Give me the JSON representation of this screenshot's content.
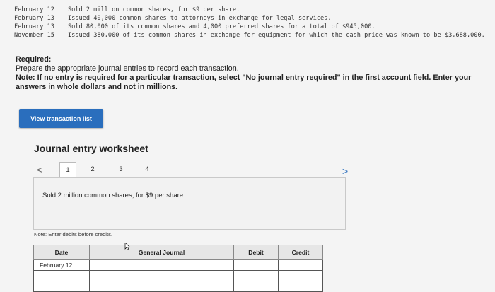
{
  "transactions": [
    {
      "date": "February 12",
      "text": "Sold 2 million common shares, for $9 per share."
    },
    {
      "date": "February 13",
      "text": "Issued 40,000 common shares to attorneys in exchange for legal services."
    },
    {
      "date": "February 13",
      "text": "Sold 80,000 of its common shares and 4,000 preferred shares for a total of $945,000."
    },
    {
      "date": "November 15",
      "text": "Issued 380,000 of its common shares in exchange for equipment for which the cash price was known to be $3,688,000."
    }
  ],
  "required": {
    "heading": "Required:",
    "line1": "Prepare the appropriate journal entries to record each transaction.",
    "note": "Note: If no entry is required for a particular transaction, select \"No journal entry required\" in the first account field. Enter your answers in whole dollars and not in millions."
  },
  "view_button_label": "View transaction list",
  "worksheet": {
    "title": "Journal entry worksheet",
    "prev": "<",
    "next": ">",
    "tabs": [
      "1",
      "2",
      "3",
      "4"
    ],
    "panel_text": "Sold 2 million common shares, for $9 per share.",
    "entry_note": "Note: Enter debits before credits."
  },
  "journal": {
    "headers": [
      "Date",
      "General Journal",
      "Debit",
      "Credit"
    ],
    "first_date": "February 12"
  }
}
